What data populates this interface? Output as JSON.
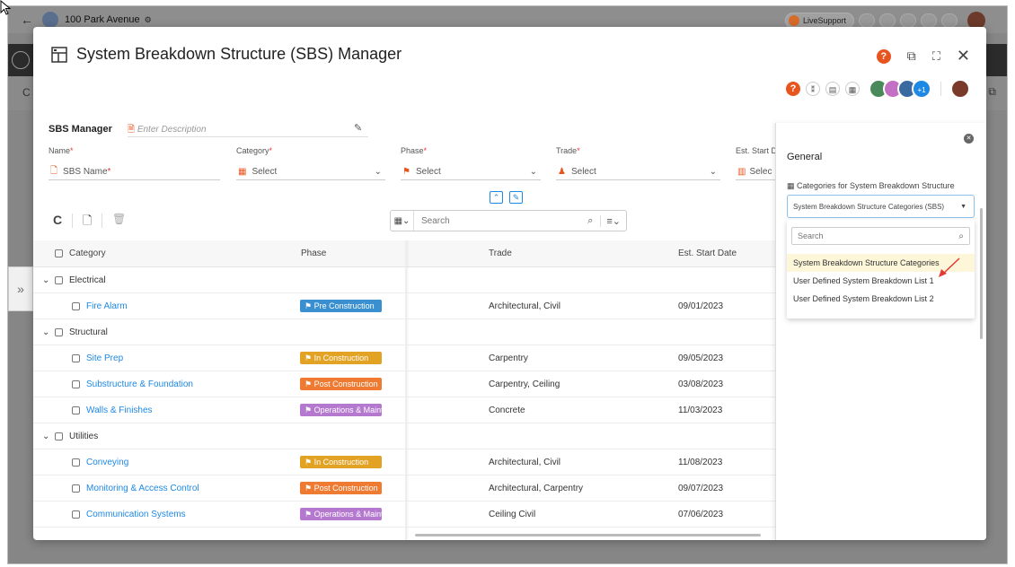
{
  "app": {
    "project_name": "100 Park Avenue",
    "live_support": "LiveSupport"
  },
  "modal": {
    "title": "System Breakdown Structure (SBS) Manager"
  },
  "form": {
    "section_title": "SBS Manager",
    "description_placeholder": "Enter Description",
    "name_label": "Name",
    "name_placeholder": "SBS Name",
    "category_label": "Category",
    "category_value": "Select",
    "phase_label": "Phase",
    "phase_value": "Select",
    "trade_label": "Trade",
    "trade_value": "Select",
    "est_start_label": "Est. Start D",
    "est_start_value": "Selec",
    "required_mark": "*"
  },
  "toolbar": {
    "search_placeholder": "Search"
  },
  "table": {
    "headers": {
      "category": "Category",
      "phase": "Phase",
      "trade": "Trade",
      "est_start": "Est. Start Date"
    },
    "rows": [
      {
        "group": "Electrical"
      },
      {
        "name": "Fire Alarm",
        "phase": "Pre Construction",
        "phase_type": "pre",
        "trade": "Architectural, Civil",
        "date": "09/01/2023"
      },
      {
        "group": "Structural"
      },
      {
        "name": "Site Prep",
        "phase": "In Construction",
        "phase_type": "in",
        "trade": "Carpentry",
        "date": "09/05/2023"
      },
      {
        "name": "Substructure & Foundation",
        "phase": "Post Construction",
        "phase_type": "post",
        "trade": "Carpentry, Ceiling",
        "date": "03/08/2023"
      },
      {
        "name": "Walls & Finishes",
        "phase": "Operations & Maint...",
        "phase_type": "ops",
        "trade": "Concrete",
        "date": "11/03/2023"
      },
      {
        "group": "Utilities"
      },
      {
        "name": "Conveying",
        "phase": "In Construction",
        "phase_type": "in",
        "trade": "Architectural, Civil",
        "date": "11/08/2023"
      },
      {
        "name": "Monitoring & Access Control",
        "phase": "Post Construction",
        "phase_type": "post",
        "trade": "Architectural, Carpentry",
        "date": "09/07/2023"
      },
      {
        "name": "Communication Systems",
        "phase": "Operations & Maint...",
        "phase_type": "ops",
        "trade": "Ceiling Civil",
        "date": "07/06/2023"
      }
    ]
  },
  "panel": {
    "title": "General",
    "section_label": "Categories for System Breakdown Structure",
    "select_value": "System Breakdown Structure Categories (SBS)",
    "search_placeholder": "Search",
    "options": [
      "System Breakdown Structure Categories",
      "User Defined System Breakdown List 1",
      "User Defined System Breakdown List 2"
    ]
  },
  "presence": {
    "more_count": "+1"
  },
  "colors": {
    "pre": "#3a8fd0",
    "in": "#e2a223",
    "post": "#ef7a31",
    "ops": "#b478cf",
    "link": "#1e88e5",
    "accent_orange": "#e8541d"
  }
}
